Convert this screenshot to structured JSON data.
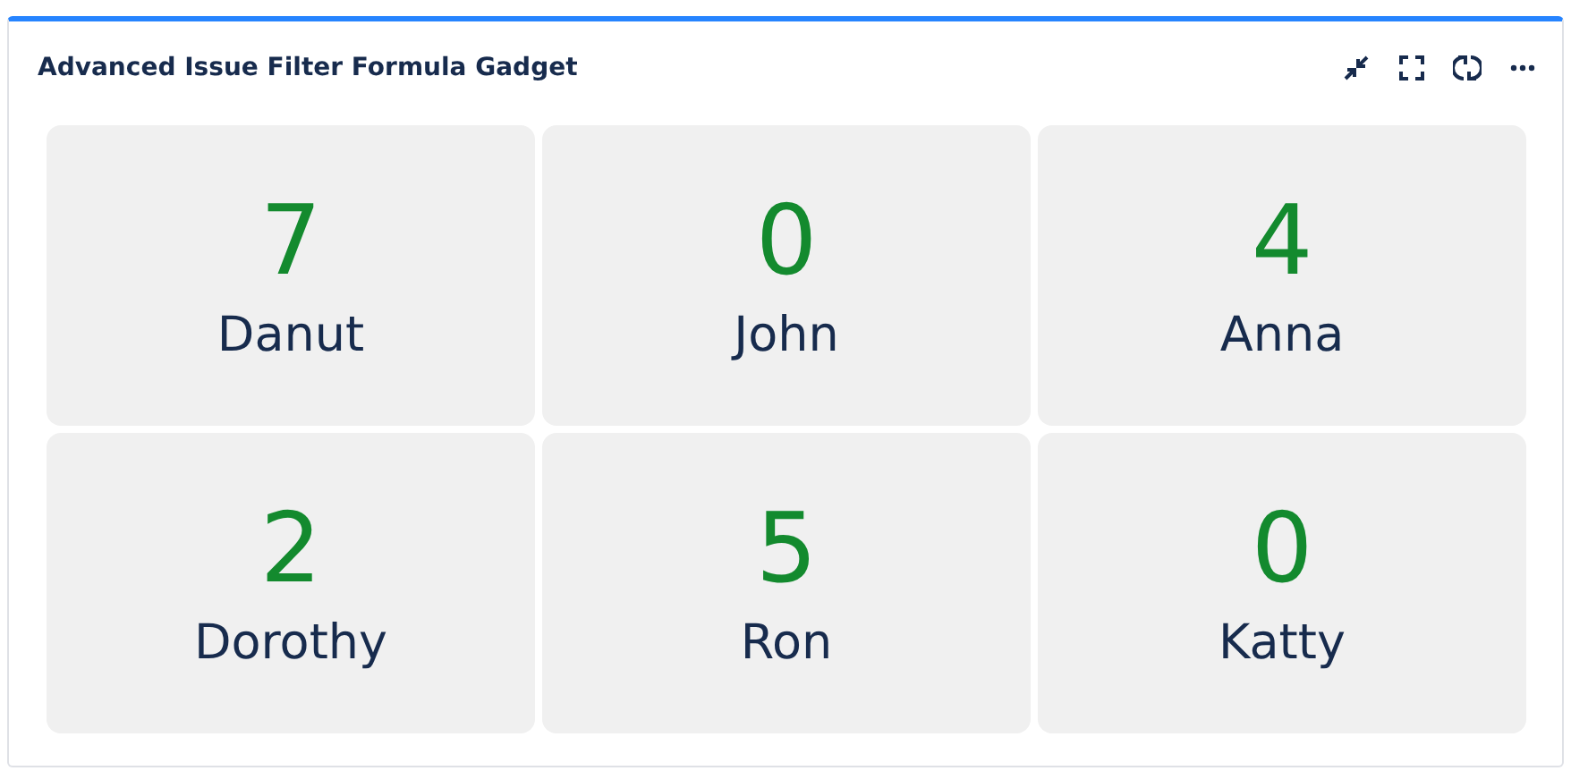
{
  "gadget": {
    "title": "Advanced Issue Filter Formula Gadget"
  },
  "cards": [
    {
      "value": "7",
      "name": "Danut"
    },
    {
      "value": "0",
      "name": "John"
    },
    {
      "value": "4",
      "name": "Anna"
    },
    {
      "value": "2",
      "name": "Dorothy"
    },
    {
      "value": "5",
      "name": "Ron"
    },
    {
      "value": "0",
      "name": "Katty"
    }
  ]
}
